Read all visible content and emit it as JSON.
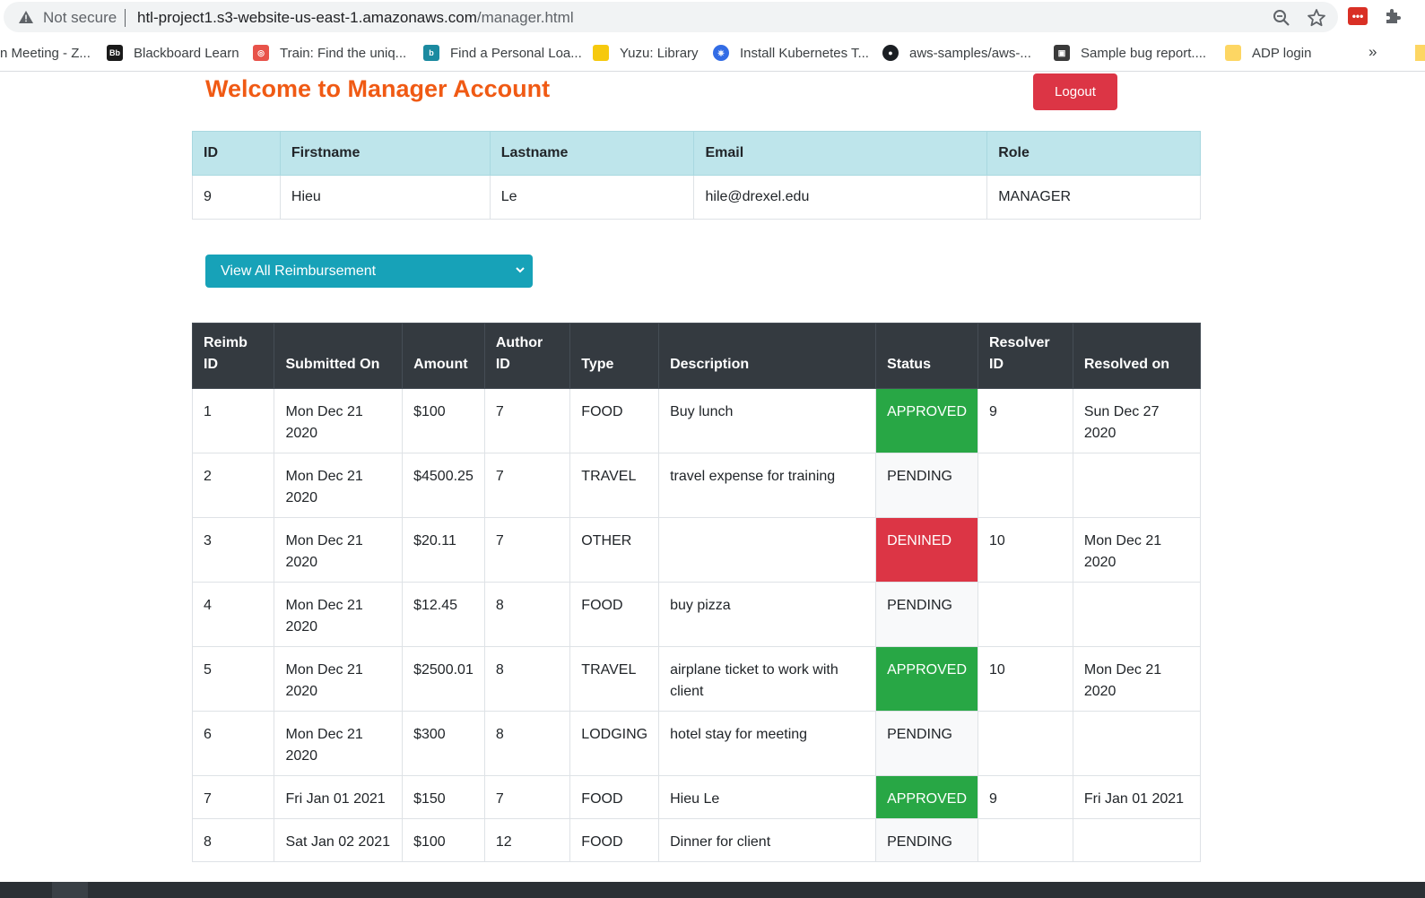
{
  "browser": {
    "security_label": "Not secure",
    "url_host": "htl-project1.s3-website-us-east-1.amazonaws.com",
    "url_path": "/manager.html",
    "extension_badge": "•••",
    "more_bookmarks": "»",
    "bookmarks": [
      {
        "label": "n Meeting - Z...",
        "icon": "zoom-meeting-icon",
        "color": ""
      },
      {
        "label": "Blackboard Learn",
        "icon": "blackboard-icon",
        "color": "#1a1a1a"
      },
      {
        "label": "Train: Find the uniq...",
        "icon": "train-icon",
        "color": "#e8534a"
      },
      {
        "label": "Find a Personal Loa...",
        "icon": "loan-icon",
        "color": "#1b8aa0"
      },
      {
        "label": "Yuzu: Library",
        "icon": "yuzu-icon",
        "color": "#f6c90e"
      },
      {
        "label": "Install Kubernetes T...",
        "icon": "kubernetes-icon",
        "color": "#326ce5"
      },
      {
        "label": "aws-samples/aws-...",
        "icon": "github-icon",
        "color": "#1b1f23"
      },
      {
        "label": "Sample bug report....",
        "icon": "bug-report-icon",
        "color": "#3a3a3a"
      },
      {
        "label": "ADP login",
        "icon": "adp-icon",
        "color": "#fdd663"
      }
    ]
  },
  "page": {
    "welcome": "Welcome to Manager Account",
    "logout_label": "Logout",
    "user_table": {
      "headers": [
        "ID",
        "Firstname",
        "Lastname",
        "Email",
        "Role"
      ],
      "row": [
        "9",
        "Hieu",
        "Le",
        "hile@drexel.edu",
        "MANAGER"
      ]
    },
    "filter_select": {
      "selected": "View All Reimbursement"
    },
    "reimb_table": {
      "headers": [
        [
          "Reimb",
          "ID"
        ],
        [
          "",
          "Submitted On"
        ],
        [
          "",
          "Amount"
        ],
        [
          "Author",
          "ID"
        ],
        [
          "",
          "Type"
        ],
        [
          "",
          "Description"
        ],
        [
          "",
          "Status"
        ],
        [
          "Resolver",
          "ID"
        ],
        [
          "",
          "Resolved on"
        ]
      ],
      "rows": [
        {
          "id": "1",
          "submitted": "Mon Dec 21 2020",
          "amount": "$100",
          "author": "7",
          "type": "FOOD",
          "description": "Buy lunch",
          "status": "APPROVED",
          "resolver": "9",
          "resolved": "Sun Dec 27 2020"
        },
        {
          "id": "2",
          "submitted": "Mon Dec 21 2020",
          "amount": "$4500.25",
          "author": "7",
          "type": "TRAVEL",
          "description": "travel expense for training",
          "status": "PENDING",
          "resolver": "",
          "resolved": ""
        },
        {
          "id": "3",
          "submitted": "Mon Dec 21 2020",
          "amount": "$20.11",
          "author": "7",
          "type": "OTHER",
          "description": "",
          "status": "DENINED",
          "resolver": "10",
          "resolved": "Mon Dec 21 2020"
        },
        {
          "id": "4",
          "submitted": "Mon Dec 21 2020",
          "amount": "$12.45",
          "author": "8",
          "type": "FOOD",
          "description": "buy pizza",
          "status": "PENDING",
          "resolver": "",
          "resolved": ""
        },
        {
          "id": "5",
          "submitted": "Mon Dec 21 2020",
          "amount": "$2500.01",
          "author": "8",
          "type": "TRAVEL",
          "description": "airplane ticket to work with client",
          "status": "APPROVED",
          "resolver": "10",
          "resolved": "Mon Dec 21 2020"
        },
        {
          "id": "6",
          "submitted": "Mon Dec 21 2020",
          "amount": "$300",
          "author": "8",
          "type": "LODGING",
          "description": "hotel stay for meeting",
          "status": "PENDING",
          "resolver": "",
          "resolved": ""
        },
        {
          "id": "7",
          "submitted": "Fri Jan 01 2021",
          "amount": "$150",
          "author": "7",
          "type": "FOOD",
          "description": "Hieu Le",
          "status": "APPROVED",
          "resolver": "9",
          "resolved": "Fri Jan 01 2021"
        },
        {
          "id": "8",
          "submitted": "Sat Jan 02 2021",
          "amount": "$100",
          "author": "12",
          "type": "FOOD",
          "description": "Dinner for client",
          "status": "PENDING",
          "resolver": "",
          "resolved": ""
        }
      ]
    }
  },
  "colors": {
    "welcome": "#f05a14",
    "logout": "#dc3545",
    "select": "#17a2b8",
    "approved": "#28a745",
    "denied": "#dc3545",
    "table_head_dark": "#343a40",
    "table_head_info": "#bee5eb"
  }
}
